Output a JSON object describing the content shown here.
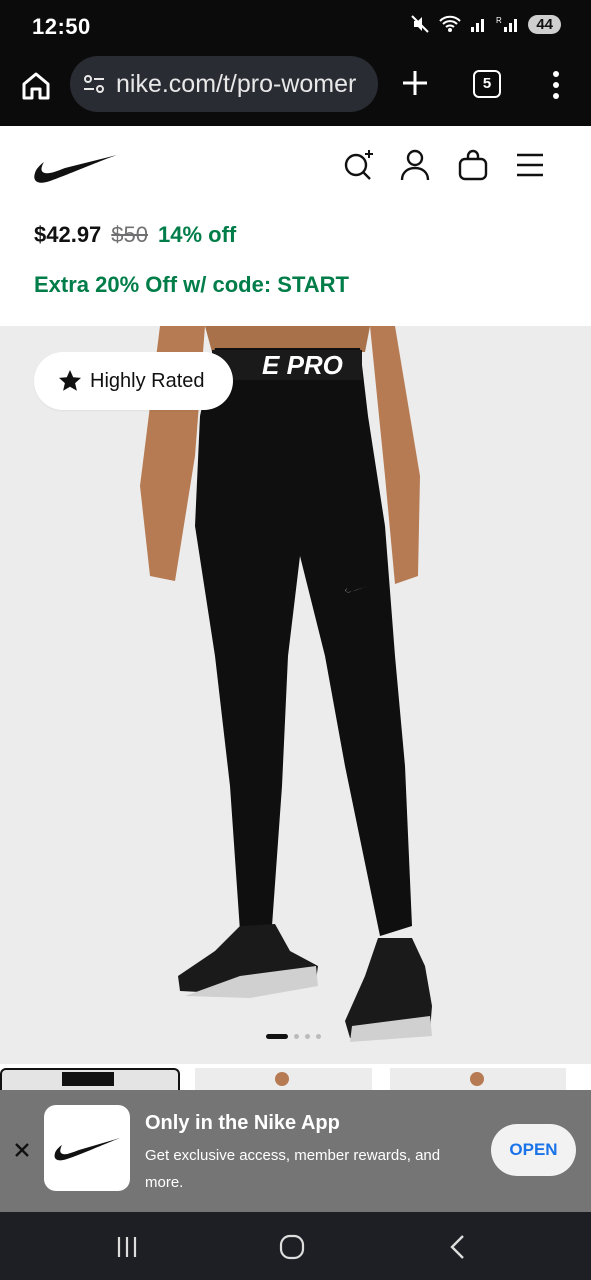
{
  "status_bar": {
    "time": "12:50",
    "battery": "44"
  },
  "browser": {
    "url": "nike.com/t/pro-womer",
    "tab_count": "5"
  },
  "product": {
    "price": "$42.97",
    "original_price": "$50",
    "discount": "14% off",
    "promo": "Extra 20% Off w/ code: START",
    "badge": "Highly Rated",
    "waistband_text": "E PRO"
  },
  "carousel": {
    "slide": 1,
    "total": 4
  },
  "app_banner": {
    "title": "Only in the Nike App",
    "description": "Get exclusive access, member rewards, and more.",
    "open_label": "OPEN"
  },
  "colors": {
    "promo_green": "#007d48",
    "banner_gray": "#757575",
    "open_blue": "#1a73e8"
  }
}
